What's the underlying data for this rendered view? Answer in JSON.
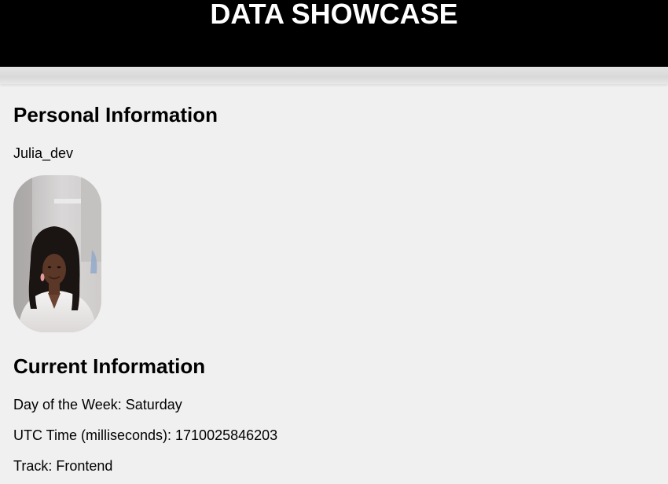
{
  "header": {
    "title": "DATA SHOWCASE"
  },
  "personal": {
    "heading": "Personal Information",
    "username": "Julia_dev",
    "avatar_alt": "Profile photo"
  },
  "current": {
    "heading": "Current Information",
    "day_of_week": "Day of the Week: Saturday",
    "utc_time": "UTC Time (milliseconds): 1710025846203",
    "track": "Track: Frontend"
  },
  "colors": {
    "header_bg": "#000000",
    "header_text": "#ffffff",
    "page_bg": "#f0f0f0"
  }
}
